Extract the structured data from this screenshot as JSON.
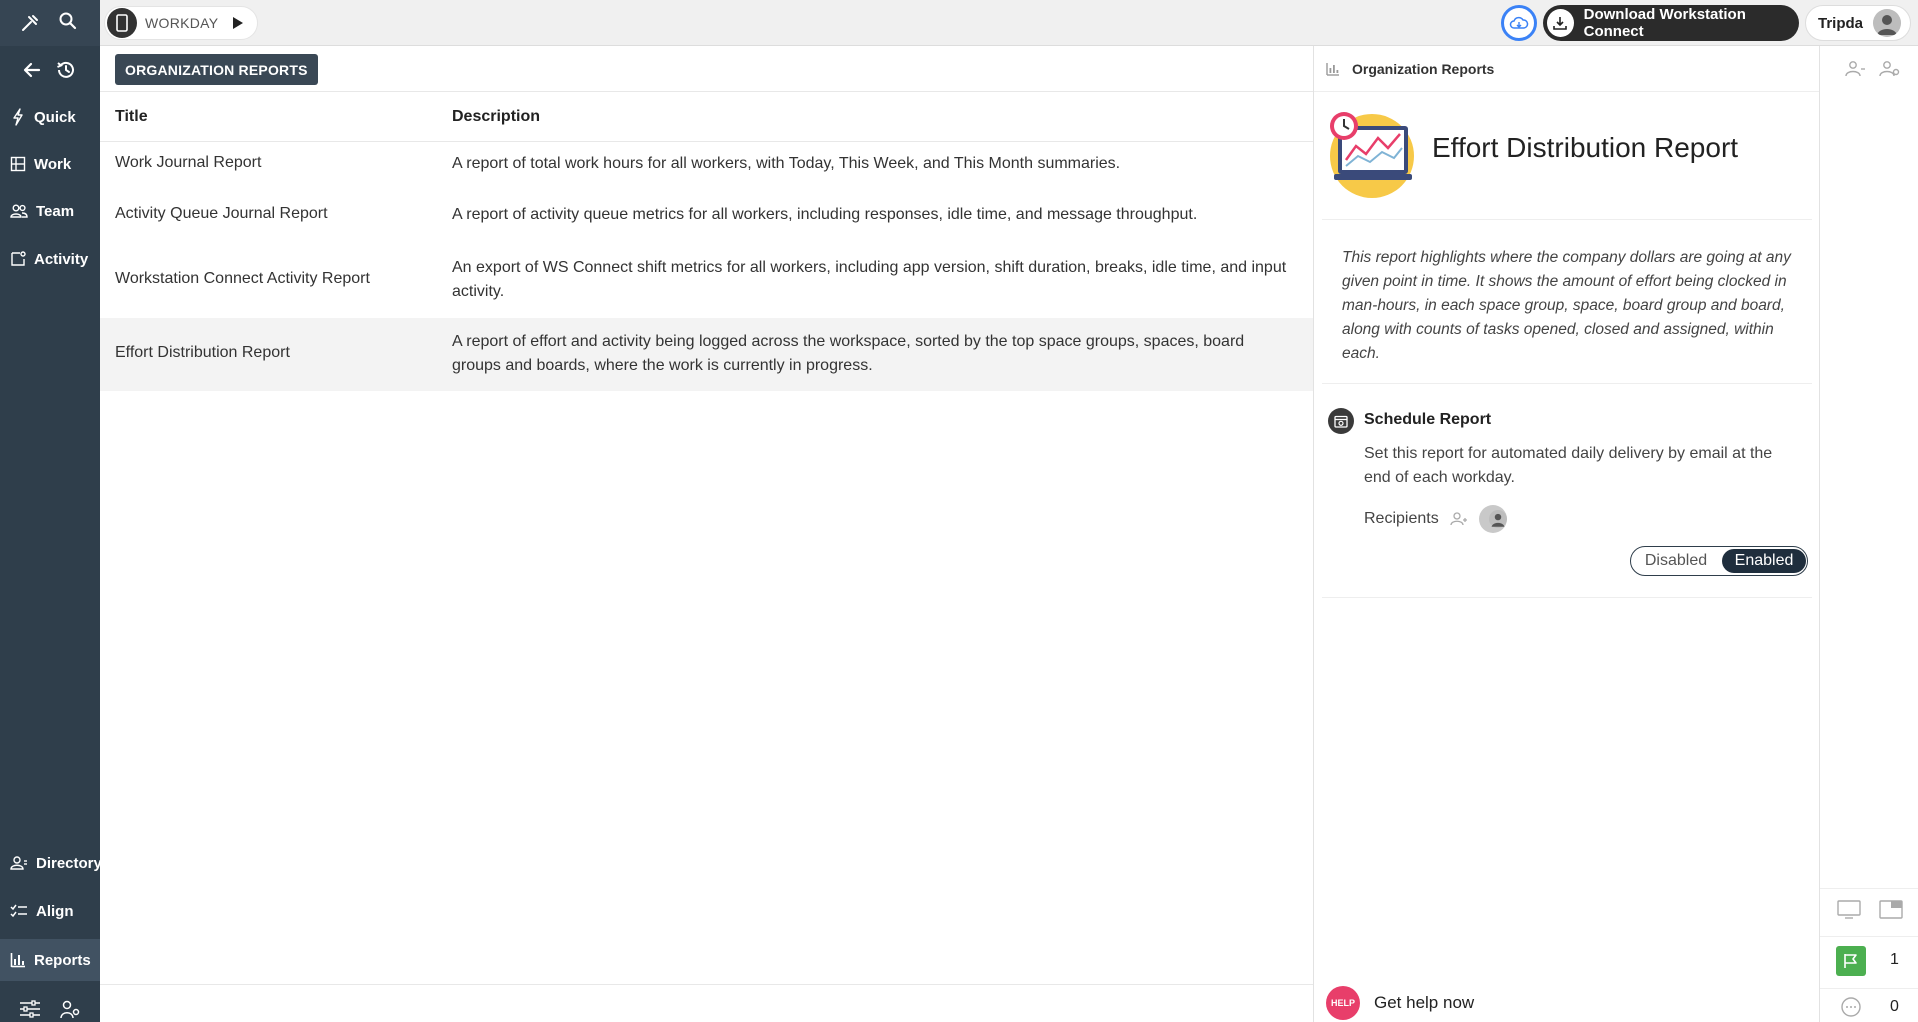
{
  "sidebar": {
    "items": [
      {
        "label": "Quick",
        "icon": "bolt-icon"
      },
      {
        "label": "Work",
        "icon": "board-icon"
      },
      {
        "label": "Team",
        "icon": "team-icon"
      },
      {
        "label": "Activity",
        "icon": "activity-icon"
      }
    ],
    "bottom_items": [
      {
        "label": "Directory",
        "icon": "directory-icon"
      },
      {
        "label": "Align",
        "icon": "checklist-icon"
      },
      {
        "label": "Reports",
        "icon": "bar-chart-icon",
        "active": true
      }
    ]
  },
  "topbar": {
    "workspace": "WORKDAY",
    "download_label": "Download Workstation Connect",
    "user_name": "Tripda"
  },
  "main": {
    "section_badge": "ORGANIZATION REPORTS",
    "columns": {
      "title": "Title",
      "description": "Description"
    },
    "rows": [
      {
        "title": "Work Journal Report",
        "description": "A report of total work hours for all workers, with Today, This Week, and This Month summaries."
      },
      {
        "title": "Activity Queue Journal Report",
        "description": "A report of activity queue metrics for all workers, including responses, idle time, and message throughput."
      },
      {
        "title": "Workstation Connect Activity Report",
        "description": "An export of WS Connect shift metrics for all workers, including app version, shift duration, breaks, idle time, and input activity."
      },
      {
        "title": "Effort Distribution Report",
        "description": "A report of effort and activity being logged across the workspace, sorted by the top space groups, spaces, board groups and boards, where the work is currently in progress.",
        "selected": true
      }
    ]
  },
  "detail": {
    "header": "Organization Reports",
    "title": "Effort Distribution Report",
    "description": "This report highlights where the company dollars are going at any given point in time. It shows the amount of effort being clocked in man-hours, in each space group, space, board group and board, along with counts of tasks opened, closed and assigned, within each.",
    "schedule": {
      "title": "Schedule Report",
      "description": "Set this report for automated daily delivery by email at the end of each workday.",
      "recipients_label": "Recipients",
      "toggle": {
        "off": "Disabled",
        "on": "Enabled",
        "value": "Enabled"
      }
    },
    "help": {
      "badge": "HELP",
      "label": "Get help now"
    }
  },
  "rail": {
    "flag_count": "1",
    "chat_count": "0"
  },
  "colors": {
    "sidebar_bg": "#2f3e4b",
    "accent_blue": "#3b82f6",
    "toggle_active": "#1f2e3d",
    "flag_green": "#4caf50",
    "help_pink": "#e83e6a"
  }
}
